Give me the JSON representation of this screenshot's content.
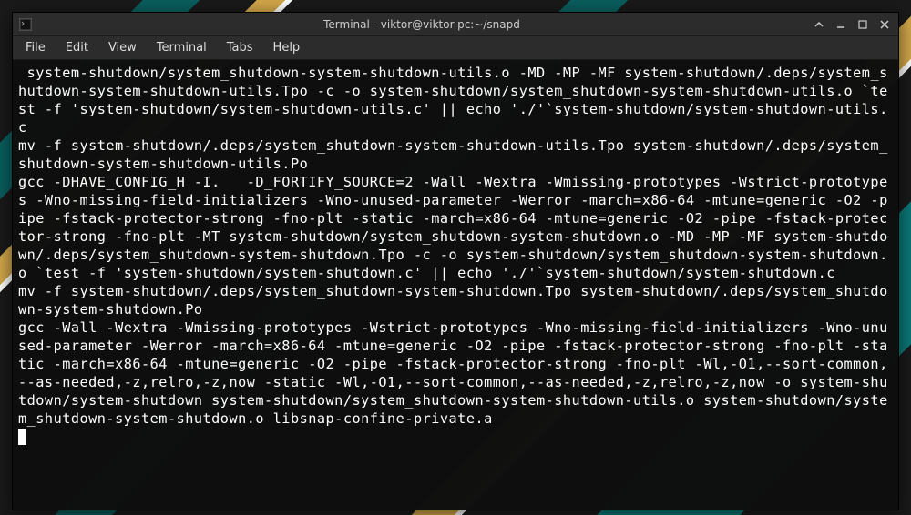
{
  "wallpaper_brand": "manjaro",
  "titlebar": {
    "title": "Terminal - viktor@viktor-pc:~/snapd"
  },
  "menubar": {
    "file": "File",
    "edit": "Edit",
    "view": "View",
    "terminal": "Terminal",
    "tabs": "Tabs",
    "help": "Help"
  },
  "terminal_output": " system-shutdown/system_shutdown-system-shutdown-utils.o -MD -MP -MF system-shutdown/.deps/system_shutdown-system-shutdown-utils.Tpo -c -o system-shutdown/system_shutdown-system-shutdown-utils.o `test -f 'system-shutdown/system-shutdown-utils.c' || echo './'`system-shutdown/system-shutdown-utils.c\nmv -f system-shutdown/.deps/system_shutdown-system-shutdown-utils.Tpo system-shutdown/.deps/system_shutdown-system-shutdown-utils.Po\ngcc -DHAVE_CONFIG_H -I.   -D_FORTIFY_SOURCE=2 -Wall -Wextra -Wmissing-prototypes -Wstrict-prototypes -Wno-missing-field-initializers -Wno-unused-parameter -Werror -march=x86-64 -mtune=generic -O2 -pipe -fstack-protector-strong -fno-plt -static -march=x86-64 -mtune=generic -O2 -pipe -fstack-protector-strong -fno-plt -MT system-shutdown/system_shutdown-system-shutdown.o -MD -MP -MF system-shutdown/.deps/system_shutdown-system-shutdown.Tpo -c -o system-shutdown/system_shutdown-system-shutdown.o `test -f 'system-shutdown/system-shutdown.c' || echo './'`system-shutdown/system-shutdown.c\nmv -f system-shutdown/.deps/system_shutdown-system-shutdown.Tpo system-shutdown/.deps/system_shutdown-system-shutdown.Po\ngcc -Wall -Wextra -Wmissing-prototypes -Wstrict-prototypes -Wno-missing-field-initializers -Wno-unused-parameter -Werror -march=x86-64 -mtune=generic -O2 -pipe -fstack-protector-strong -fno-plt -static -march=x86-64 -mtune=generic -O2 -pipe -fstack-protector-strong -fno-plt -Wl,-O1,--sort-common,--as-needed,-z,relro,-z,now -static -Wl,-O1,--sort-common,--as-needed,-z,relro,-z,now -o system-shutdown/system-shutdown system-shutdown/system_shutdown-system-shutdown-utils.o system-shutdown/system_shutdown-system-shutdown.o libsnap-confine-private.a"
}
